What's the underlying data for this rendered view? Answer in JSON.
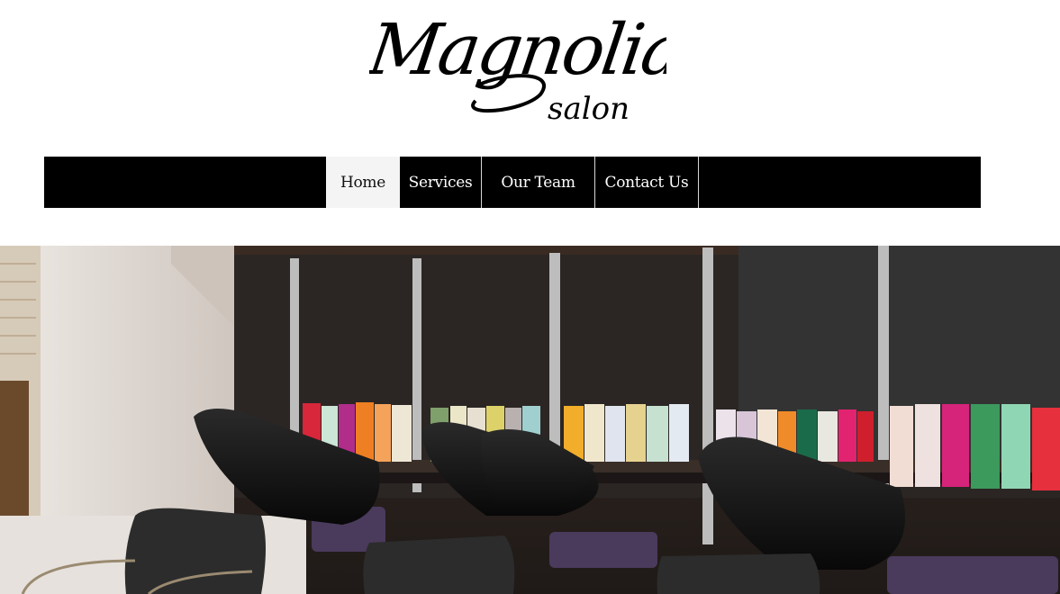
{
  "brand": {
    "name": "Magnolia",
    "tagline": "salon"
  },
  "nav": {
    "items": [
      {
        "label": "Home",
        "active": true
      },
      {
        "label": "Services",
        "active": false
      },
      {
        "label": "Our Team",
        "active": false
      },
      {
        "label": "Contact Us",
        "active": false
      }
    ]
  },
  "hero": {
    "image": "salon-interior-photo"
  },
  "colors": {
    "nav_background": "#000000",
    "nav_active_background": "#f4f4f4",
    "nav_text": "#ffffff"
  }
}
